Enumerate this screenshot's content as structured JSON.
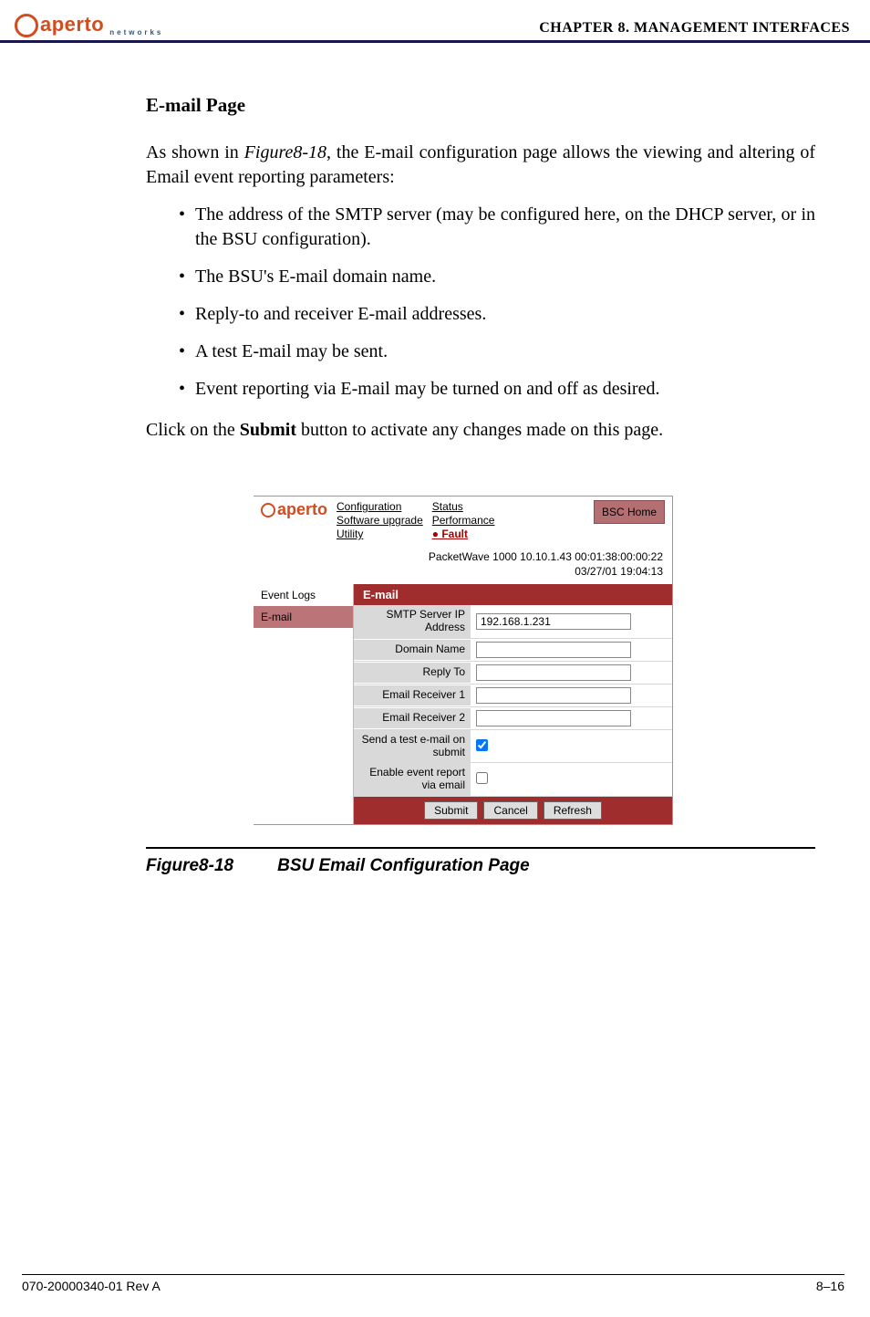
{
  "header": {
    "logo_text": "aperto",
    "logo_sub": "networks",
    "chapter": "CHAPTER 8.   MANAGEMENT INTERFACES"
  },
  "section": {
    "heading": "E-mail Page",
    "intro_prefix": "As shown in ",
    "intro_ref": "Figure8-18",
    "intro_suffix": ", the E-mail configuration page allows the viewing and altering of Email event reporting parameters:",
    "bullets": [
      "The address of the SMTP server (may be configured here, on the DHCP server, or in the BSU configuration).",
      "The BSU's E-mail domain name.",
      "Reply-to and receiver E-mail addresses.",
      "A test E-mail may be sent.",
      "Event reporting via E-mail may be turned on and off as desired."
    ],
    "closing_prefix": "Click on the ",
    "closing_bold": "Submit",
    "closing_suffix": " button to activate any changes made on this page."
  },
  "figure": {
    "logo_text": "aperto",
    "nav1": {
      "a": "Configuration",
      "b": "Software upgrade",
      "c": "Utility"
    },
    "nav2": {
      "a": "Status",
      "b": "Performance",
      "c": "Fault"
    },
    "home": "BSC Home",
    "status_line1": "PacketWave 1000    10.10.1.43    00:01:38:00:00:22",
    "status_line2": "03/27/01    19:04:13",
    "side1": "Event Logs",
    "side2": "E-mail",
    "sec_head": "E-mail",
    "rows": {
      "r1": {
        "label": "SMTP Server IP Address",
        "value": "192.168.1.231"
      },
      "r2": {
        "label": "Domain Name",
        "value": ""
      },
      "r3": {
        "label": "Reply To",
        "value": ""
      },
      "r4": {
        "label": "Email Receiver 1",
        "value": ""
      },
      "r5": {
        "label": "Email Receiver 2",
        "value": ""
      },
      "r6": {
        "label": "Send a test e-mail on submit"
      },
      "r7": {
        "label": "Enable event report via email"
      }
    },
    "buttons": {
      "submit": "Submit",
      "cancel": "Cancel",
      "refresh": "Refresh"
    },
    "caption_num": "Figure8-18",
    "caption_text": "BSU Email Configuration Page"
  },
  "footer": {
    "left": "070-20000340-01 Rev A",
    "right": "8–16"
  }
}
